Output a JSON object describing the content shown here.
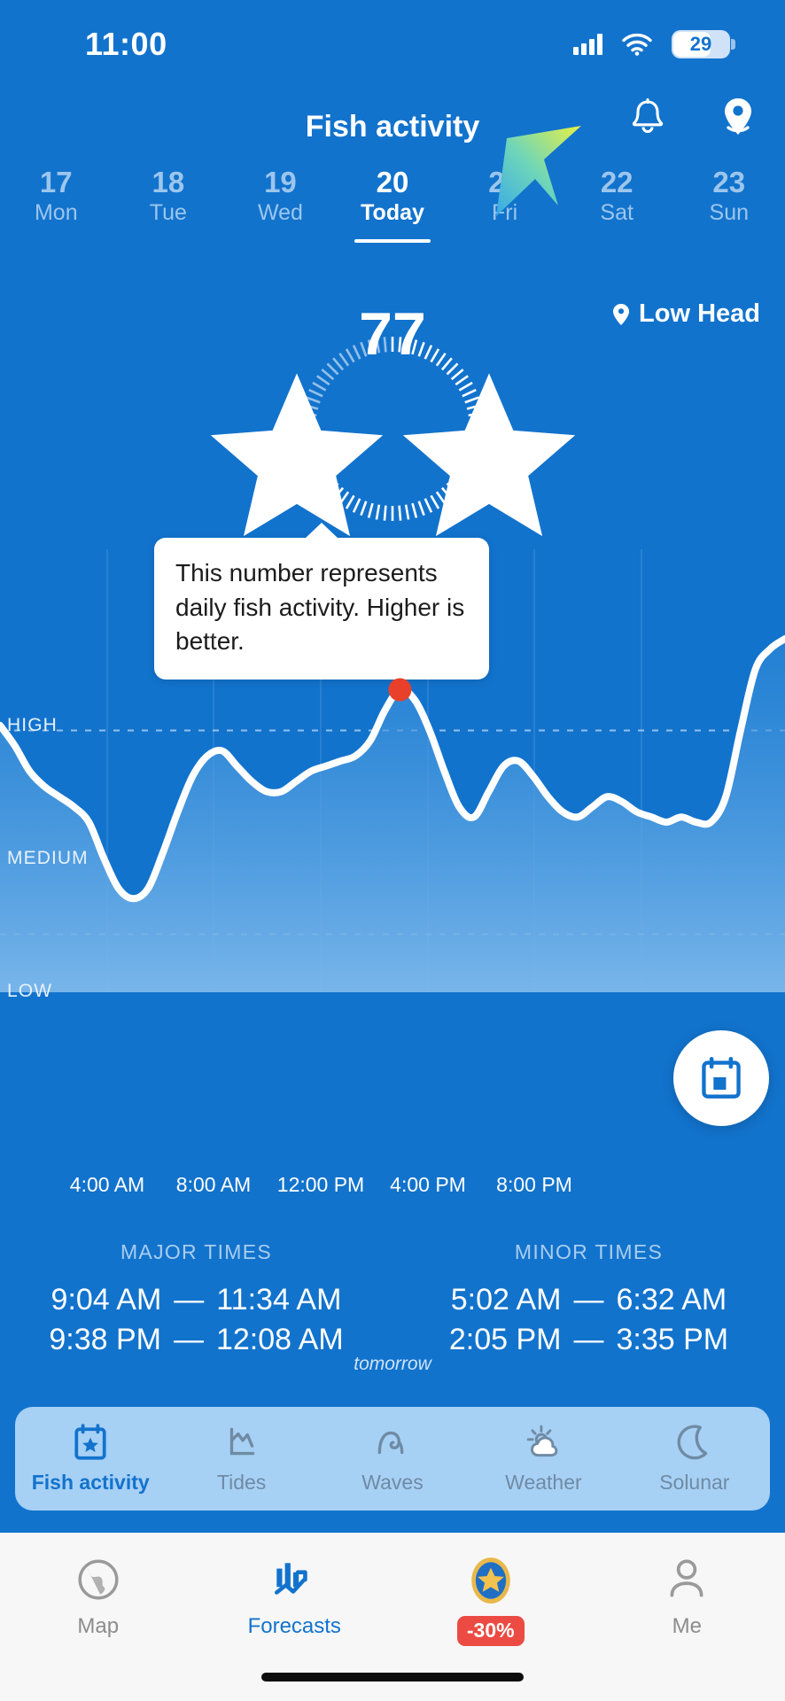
{
  "status_bar": {
    "time": "11:00",
    "battery_level": "29",
    "icons": [
      "cellular-signal-icon",
      "wifi-icon",
      "battery-icon"
    ]
  },
  "header": {
    "title": "Fish activity",
    "bell_icon": "bell-icon",
    "location_pin_icon": "location-pin-icon"
  },
  "dates": [
    {
      "day": "17",
      "weekday": "Mon",
      "active": false
    },
    {
      "day": "18",
      "weekday": "Tue",
      "active": false
    },
    {
      "day": "19",
      "weekday": "Wed",
      "active": false
    },
    {
      "day": "20",
      "weekday": "Today",
      "active": true
    },
    {
      "day": "21",
      "weekday": "Fri",
      "active": false
    },
    {
      "day": "22",
      "weekday": "Sat",
      "active": false
    },
    {
      "day": "23",
      "weekday": "Sun",
      "active": false
    }
  ],
  "location": {
    "name": "Low Head",
    "icon": "map-pin-icon"
  },
  "score": {
    "value": "77",
    "stars": 2,
    "max_stars": 2
  },
  "tooltip": {
    "text": "This number represents daily fish activity. Higher is better."
  },
  "chart_data": {
    "type": "area",
    "title": "Fish activity",
    "xlabel": "",
    "ylabel": "",
    "ylim": [
      0,
      100
    ],
    "ytick_labels": [
      "HIGH",
      "MEDIUM",
      "LOW"
    ],
    "ytick_values": [
      88,
      58,
      25
    ],
    "gridlines": {
      "horizontal_dashed_at": [
        70,
        30
      ],
      "vertical_at": [
        "4:00 AM",
        "8:00 AM",
        "12:00 PM",
        "4:00 PM",
        "8:00 PM"
      ]
    },
    "xtick_labels": [
      "4:00 AM",
      "8:00 AM",
      "12:00 PM",
      "4:00 PM",
      "8:00 PM"
    ],
    "highlight_point": {
      "x_label": "11:00 AM",
      "y": 78,
      "color": "#e8402a"
    },
    "line_color": "#ffffff",
    "fill_color": "#5ba3e3",
    "x": [
      0,
      0.5,
      1,
      1.5,
      2,
      2.5,
      3,
      3.5,
      4,
      4.5,
      5,
      5.5,
      6,
      6.5,
      7,
      7.5,
      8,
      8.5,
      9,
      9.5,
      10,
      10.5,
      11,
      11.5,
      12,
      12.5,
      13,
      13.5,
      14,
      14.5,
      15,
      15.5,
      16,
      16.5,
      17,
      17.5,
      18,
      18.5,
      19,
      19.5,
      20,
      20.5,
      21,
      21.5,
      22,
      22.5,
      23,
      23.5,
      24
    ],
    "values": [
      71,
      67,
      62,
      59,
      57,
      55,
      52,
      45,
      39,
      37,
      39,
      46,
      54,
      61,
      65,
      66,
      63,
      60,
      58,
      58,
      60,
      62,
      63,
      64,
      65,
      68,
      74,
      78,
      76,
      70,
      62,
      55,
      53,
      58,
      63,
      64,
      61,
      57,
      54,
      53,
      55,
      57,
      56,
      54,
      53,
      52,
      53,
      52,
      52,
      57,
      70,
      82,
      86,
      88
    ]
  },
  "major_times": {
    "header": "MAJOR TIMES",
    "rows": [
      {
        "start": "9:04 AM",
        "dash": "—",
        "end": "11:34 AM"
      },
      {
        "start": "9:38 PM",
        "dash": "—",
        "end": "12:08 AM"
      }
    ],
    "note": "tomorrow"
  },
  "minor_times": {
    "header": "MINOR TIMES",
    "rows": [
      {
        "start": "5:02 AM",
        "dash": "—",
        "end": "6:32 AM"
      },
      {
        "start": "2:05 PM",
        "dash": "—",
        "end": "3:35 PM"
      }
    ]
  },
  "fab": {
    "icon": "calendar-icon"
  },
  "category_tabs": [
    {
      "label": "Fish activity",
      "icon": "calendar-star-icon",
      "active": true
    },
    {
      "label": "Tides",
      "icon": "tide-chart-icon",
      "active": false
    },
    {
      "label": "Waves",
      "icon": "wave-icon",
      "active": false
    },
    {
      "label": "Weather",
      "icon": "sun-cloud-icon",
      "active": false
    },
    {
      "label": "Solunar",
      "icon": "moon-icon",
      "active": false
    }
  ],
  "bottom_nav": [
    {
      "label": "Map",
      "icon": "globe-icon",
      "active": false,
      "badge": ""
    },
    {
      "label": "Forecasts",
      "icon": "bar-chart-arrow-icon",
      "active": true,
      "badge": ""
    },
    {
      "label": "",
      "icon": "premium-star-icon",
      "active": false,
      "badge": "-30%"
    },
    {
      "label": "Me",
      "icon": "person-icon",
      "active": false,
      "badge": ""
    }
  ],
  "colors": {
    "brand_blue": "#1273cd",
    "accent_red": "#eb4b42",
    "tab_bg": "#a7d0f5",
    "nav_bg": "#f7f7f7",
    "chart_fill": "#5ba3e3"
  }
}
